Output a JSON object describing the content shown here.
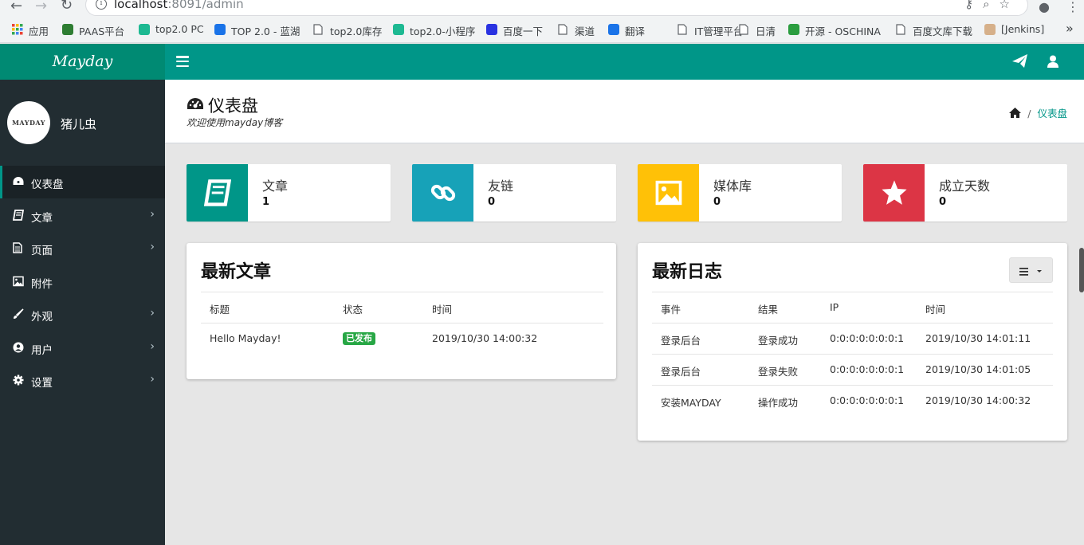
{
  "browser": {
    "url_host": "localhost",
    "url_rest": ":8091/admin",
    "bookmarks": [
      {
        "label": "应用",
        "icon": "apps-grid-icon"
      },
      {
        "label": "PAAS平台",
        "icon": "paas-icon"
      },
      {
        "label": "top2.0 PC",
        "icon": "play-icon"
      },
      {
        "label": "TOP 2.0 - 蓝湖",
        "icon": "lanhu-icon"
      },
      {
        "label": "top2.0库存",
        "icon": "page-icon"
      },
      {
        "label": "top2.0-小程序",
        "icon": "play-icon"
      },
      {
        "label": "百度一下",
        "icon": "baidu-icon"
      },
      {
        "label": "渠道",
        "icon": "page-icon"
      },
      {
        "label": "翻译",
        "icon": "translate-icon"
      },
      {
        "label": "IT管理平台",
        "icon": "page-icon"
      },
      {
        "label": "日清",
        "icon": "page-icon"
      },
      {
        "label": "开源 - OSCHINA",
        "icon": "oschina-icon"
      },
      {
        "label": "百度文库下载",
        "icon": "page-icon"
      },
      {
        "label": "[Jenkins]",
        "icon": "jenkins-icon"
      }
    ],
    "more": "»"
  },
  "brand": "Mayday",
  "sidebar": {
    "avatar_text": "MAYDAY",
    "username": "猪儿虫",
    "items": [
      {
        "label": "仪表盘",
        "icon": "dashboard-icon",
        "active": true,
        "has_children": false
      },
      {
        "label": "文章",
        "icon": "book-icon",
        "active": false,
        "has_children": true
      },
      {
        "label": "页面",
        "icon": "file-icon",
        "active": false,
        "has_children": true
      },
      {
        "label": "附件",
        "icon": "image-icon",
        "active": false,
        "has_children": false
      },
      {
        "label": "外观",
        "icon": "brush-icon",
        "active": false,
        "has_children": true
      },
      {
        "label": "用户",
        "icon": "user-circle-icon",
        "active": false,
        "has_children": true
      },
      {
        "label": "设置",
        "icon": "gear-icon",
        "active": false,
        "has_children": true
      }
    ],
    "chevron": "›"
  },
  "header": {
    "title": "仪表盘",
    "subtitle": "欢迎使用mayday博客",
    "breadcrumb_sep": "/",
    "breadcrumb_current": "仪表盘"
  },
  "stats": [
    {
      "label": "文章",
      "value": "1",
      "color": "#009688",
      "icon": "book-icon"
    },
    {
      "label": "友链",
      "value": "0",
      "color": "#17a2b8",
      "icon": "link-icon"
    },
    {
      "label": "媒体库",
      "value": "0",
      "color": "#ffc107",
      "icon": "image-icon"
    },
    {
      "label": "成立天数",
      "value": "0",
      "color": "#dc3545",
      "icon": "star-icon"
    }
  ],
  "latest_posts": {
    "title": "最新文章",
    "columns": [
      "标题",
      "状态",
      "时间"
    ],
    "rows": [
      {
        "title": "Hello Mayday!",
        "status": "已发布",
        "time": "2019/10/30 14:00:32"
      }
    ]
  },
  "latest_logs": {
    "title": "最新日志",
    "columns": [
      "事件",
      "结果",
      "IP",
      "时间"
    ],
    "rows": [
      {
        "event": "登录后台",
        "result": "登录成功",
        "ip": "0:0:0:0:0:0:0:1",
        "time": "2019/10/30 14:01:11"
      },
      {
        "event": "登录后台",
        "result": "登录失败",
        "ip": "0:0:0:0:0:0:0:1",
        "time": "2019/10/30 14:01:05"
      },
      {
        "event": "安装MAYDAY",
        "result": "操作成功",
        "ip": "0:0:0:0:0:0:0:1",
        "time": "2019/10/30 14:00:32"
      }
    ]
  }
}
